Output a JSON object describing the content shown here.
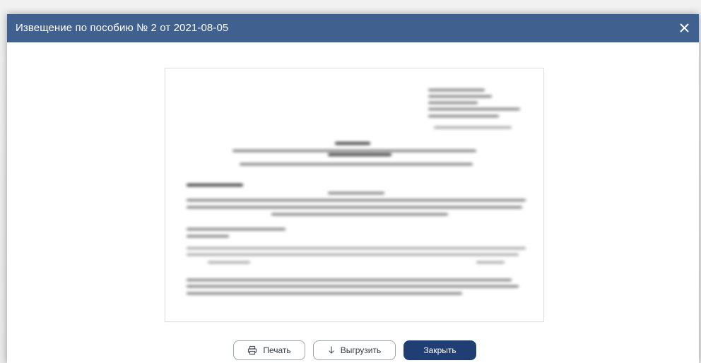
{
  "dialog": {
    "title": "Извещение по пособию № 2 от 2021-08-05",
    "close_icon": "close-icon"
  },
  "preview": {
    "state": "blurred"
  },
  "footer": {
    "print_label": "Печать",
    "print_icon": "printer-icon",
    "download_label": "Выгрузить",
    "download_icon": "arrow-down-icon",
    "close_label": "Закрыть"
  },
  "colors": {
    "titlebar": "#40608f",
    "primary_button": "#1f3f74",
    "outline_border": "#9aa4b1"
  }
}
